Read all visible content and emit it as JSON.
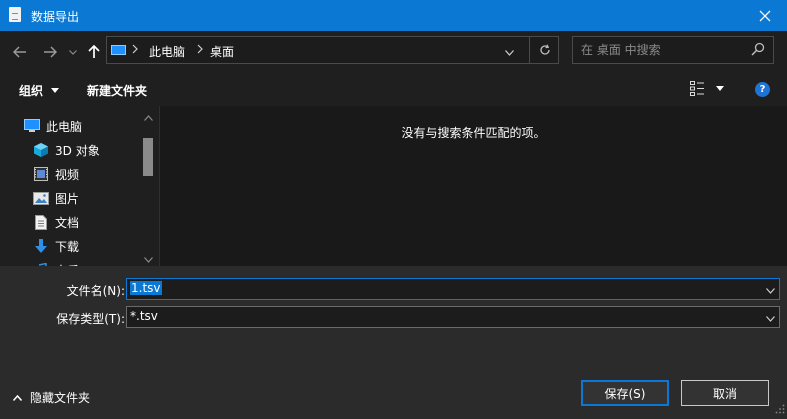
{
  "window": {
    "title": "数据导出"
  },
  "address": {
    "root": "此电脑",
    "current": "桌面"
  },
  "search": {
    "placeholder": "在 桌面 中搜索"
  },
  "toolbar": {
    "organize_label": "组织",
    "new_folder_label": "新建文件夹",
    "help_label": "?"
  },
  "sidebar": {
    "items": [
      {
        "label": "此电脑",
        "icon": "computer-icon"
      },
      {
        "label": "3D 对象",
        "icon": "cube-icon"
      },
      {
        "label": "视频",
        "icon": "video-icon"
      },
      {
        "label": "图片",
        "icon": "picture-icon"
      },
      {
        "label": "文档",
        "icon": "document-icon"
      },
      {
        "label": "下载",
        "icon": "download-icon"
      },
      {
        "label": "音乐",
        "icon": "music-icon"
      }
    ]
  },
  "main": {
    "empty_message": "没有与搜索条件匹配的项。"
  },
  "form": {
    "filename_label": "文件名(N):",
    "filename_value": "1.tsv",
    "filetype_label": "保存类型(T):",
    "filetype_value": "*.tsv"
  },
  "footer": {
    "hide_folders_label": "隐藏文件夹",
    "save_label": "保存(S)",
    "cancel_label": "取消"
  },
  "colors": {
    "accent": "#0b78d4",
    "background": "#2b2b2b",
    "pane": "#191919",
    "bar": "#1f1f1f"
  }
}
